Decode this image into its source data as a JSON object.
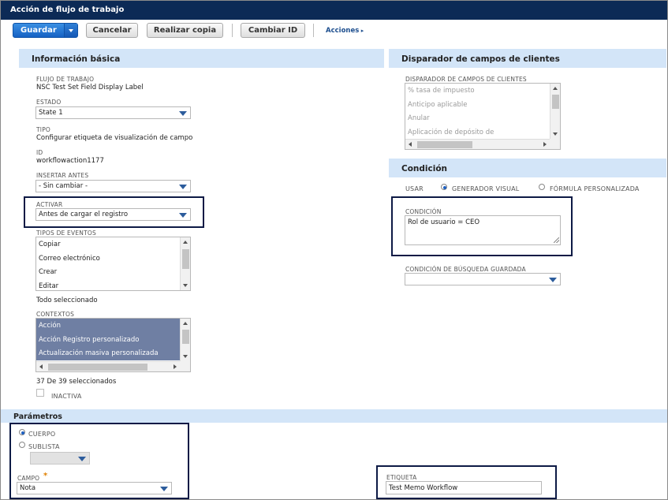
{
  "window": {
    "title": "Acción de flujo de trabajo"
  },
  "toolbar": {
    "save_label": "Guardar",
    "cancel_label": "Cancelar",
    "copy_label": "Realizar copia",
    "change_id_label": "Cambiar ID",
    "actions_label": "Acciones"
  },
  "basic_info": {
    "section_title": "Información básica",
    "workflow_label": "FLUJO DE TRABAJO",
    "workflow_value": "NSC Test Set Field Display Label",
    "state_label": "ESTADO",
    "state_value": "State 1",
    "type_label": "TIPO",
    "type_value": "Configurar etiqueta de visualización de campo",
    "id_label": "ID",
    "id_value": "workflowaction1177",
    "insert_before_label": "INSERTAR ANTES",
    "insert_before_value": "- Sin cambiar -",
    "trigger_label": "ACTIVAR",
    "trigger_value": "Antes de cargar el registro",
    "event_types_label": "TIPOS DE EVENTOS",
    "event_types": [
      "Copiar",
      "Correo electrónico",
      "Crear",
      "Editar"
    ],
    "event_types_status": "Todo seleccionado",
    "contexts_label": "CONTEXTOS",
    "contexts": [
      "Acción",
      "Acción Registro personalizado",
      "Actualización masiva personalizada"
    ],
    "contexts_status": "37 De 39 seleccionados",
    "inactive_label": "INACTIVA"
  },
  "client_trigger": {
    "section_title": "Disparador de campos de clientes",
    "list_label": "DISPARADOR DE CAMPOS DE CLIENTES",
    "items": [
      "% tasa de impuesto",
      "Anticipo aplicable",
      "Anular",
      "Aplicación de depósito de"
    ]
  },
  "condition": {
    "section_title": "Condición",
    "use_label": "USAR",
    "visual_label": "GENERADOR VISUAL",
    "formula_label": "FÓRMULA PERSONALIZADA",
    "condition_label": "CONDICIÓN",
    "condition_value": "Rol de usuario = CEO",
    "saved_search_label": "CONDICIÓN DE BÚSQUEDA GUARDADA",
    "saved_search_value": ""
  },
  "parameters": {
    "section_title": "Parámetros",
    "body_label": "CUERPO",
    "sublist_label": "SUBLISTA",
    "field_label": "CAMPO",
    "required_mark": "*",
    "field_value": "Nota",
    "tag_label": "ETIQUETA",
    "tag_value": "Test Memo Workflow"
  },
  "colors": {
    "title_bar": "#0c2a56",
    "section_header": "#d3e5f8",
    "primary_button": "#1662c4",
    "selected_list": "#6f7fa3",
    "highlight_box": "#0d1a45"
  }
}
